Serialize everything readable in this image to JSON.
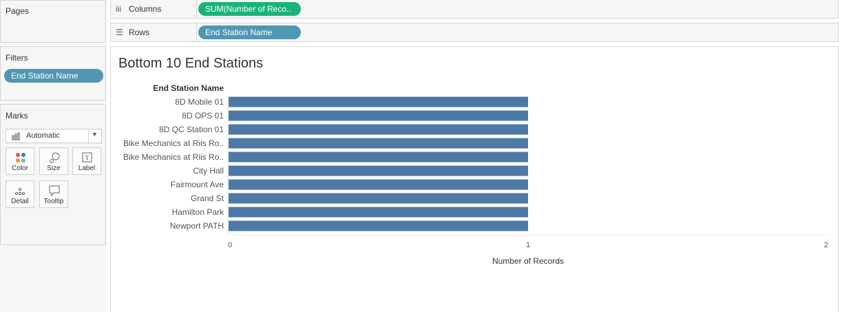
{
  "pages": {
    "title": "Pages"
  },
  "filters": {
    "title": "Filters",
    "pill": "End Station Name"
  },
  "marks": {
    "title": "Marks",
    "mark_type": "Automatic",
    "buttons": [
      {
        "label": "Color",
        "icon": "color-icon"
      },
      {
        "label": "Size",
        "icon": "size-icon"
      },
      {
        "label": "Label",
        "icon": "label-icon"
      },
      {
        "label": "Detail",
        "icon": "detail-icon"
      },
      {
        "label": "Tooltip",
        "icon": "tooltip-icon"
      }
    ]
  },
  "shelves": {
    "columns": {
      "label": "Columns",
      "pill": "SUM(Number of Reco.."
    },
    "rows": {
      "label": "Rows",
      "pill": "End Station Name"
    }
  },
  "colors": {
    "bar": "#4e79a7",
    "dimension_pill": "#4f97b3",
    "measure_pill": "#1bb37a"
  },
  "chart_data": {
    "type": "bar",
    "title": "Bottom 10 End Stations",
    "row_header": "End Station Name",
    "xlabel": "Number of Records",
    "categories": [
      "8D Mobile 01",
      "8D OPS 01",
      "8D QC Station 01",
      "Bike Mechanics at Riis Ro..",
      "Bike Mechanics at Riis Ro..",
      "City Hall",
      "Fairmount Ave",
      "Grand St",
      "Hamilton Park",
      "Newport PATH"
    ],
    "values": [
      1,
      1,
      1,
      1,
      1,
      1,
      1,
      1,
      1,
      1
    ],
    "xlim": [
      0,
      2
    ],
    "xticks": [
      "0",
      "1",
      "2"
    ]
  }
}
